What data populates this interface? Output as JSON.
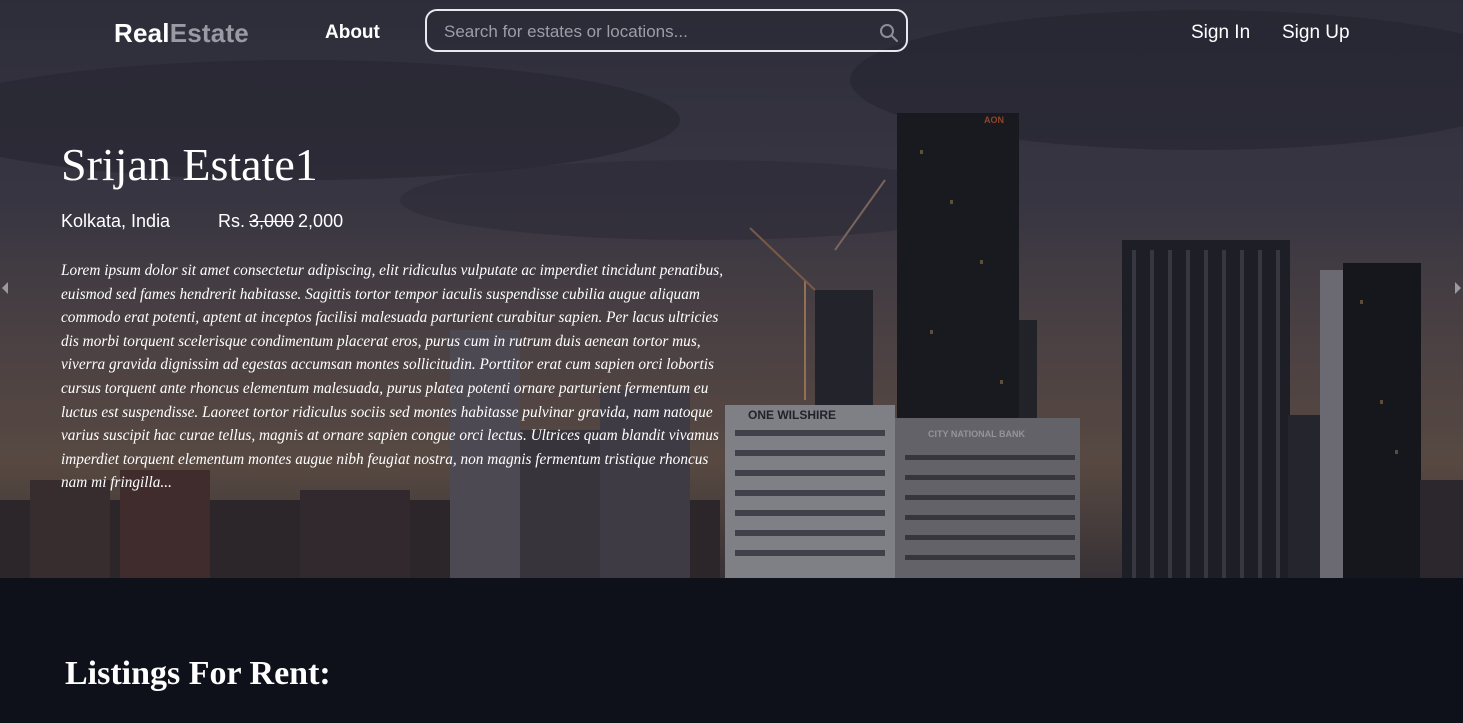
{
  "nav": {
    "logo_part1": "Real",
    "logo_part2": "Estate",
    "about": "About",
    "search_placeholder": "Search for estates or locations...",
    "sign_in": "Sign In",
    "sign_up": "Sign Up"
  },
  "hero": {
    "title": "Srijan Estate1",
    "location": "Kolkata, India",
    "currency": "Rs.",
    "old_price": "3,000",
    "new_price": "2,000",
    "description": "Lorem ipsum dolor sit amet consectetur adipiscing, elit ridiculus vulputate ac imperdiet tincidunt penatibus, euismod sed fames hendrerit habitasse. Sagittis tortor tempor iaculis suspendisse cubilia augue aliquam commodo erat potenti, aptent at inceptos facilisi malesuada parturient curabitur sapien. Per lacus ultricies dis morbi torquent scelerisque condimentum placerat eros, purus cum in rutrum duis aenean tortor mus, viverra gravida dignissim ad egestas accumsan montes sollicitudin. Porttitor erat cum sapien orci lobortis cursus torquent ante rhoncus elementum malesuada, purus platea potenti ornare parturient fermentum eu luctus est suspendisse. Laoreet tortor ridiculus sociis sed montes habitasse pulvinar gravida, nam natoque varius suscipit hac curae tellus, magnis at ornare sapien congue orci lectus. Ultrices quam blandit vivamus imperdiet torquent elementum montes augue nibh feugiat nostra, non magnis fermentum tristique rhoncus nam mi fringilla...",
    "building_sign_1": "ONE WILSHIRE",
    "building_sign_2": "CITY NATIONAL BANK",
    "building_sign_3": "AON"
  },
  "listings": {
    "heading": "Listings For Rent:"
  },
  "icons": {
    "search": "search-icon",
    "prev": "chevron-left-icon",
    "next": "chevron-right-icon"
  },
  "colors": {
    "page_bg": "#0f111a",
    "logo_accent": "#9a9aa2"
  }
}
